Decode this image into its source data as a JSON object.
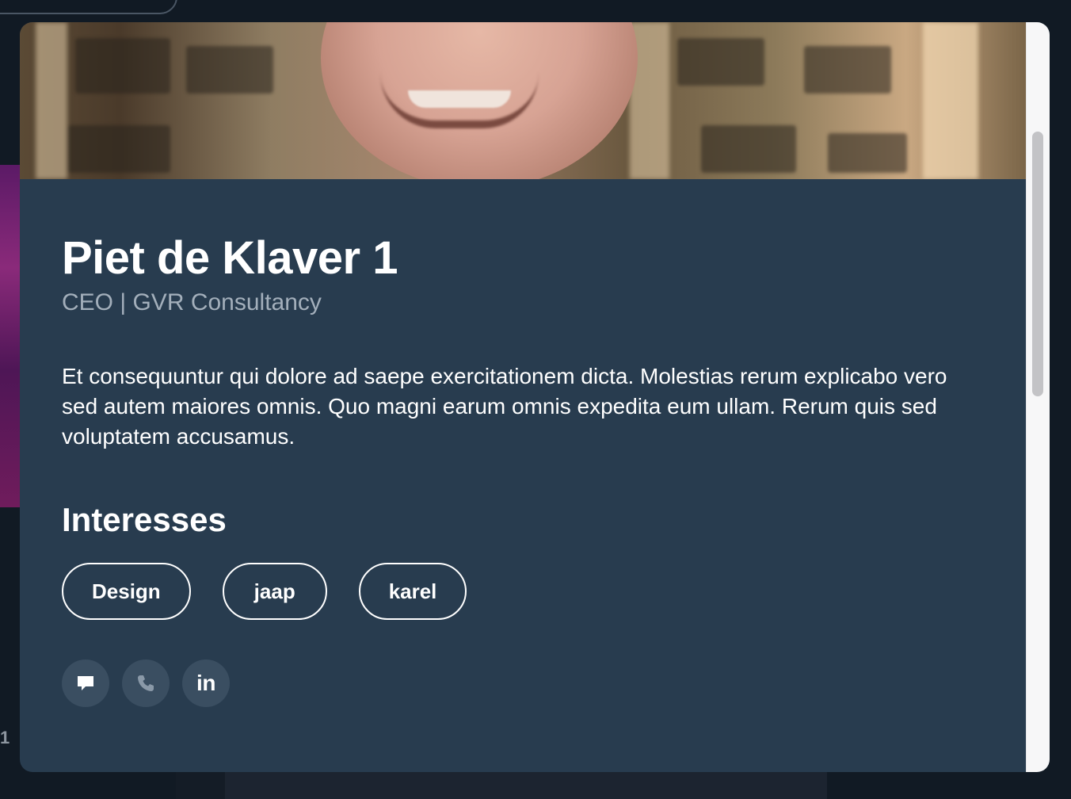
{
  "profile": {
    "name": "Piet de Klaver 1",
    "subtitle": "CEO | GVR Consultancy",
    "bio": "Et consequuntur qui dolore ad saepe exercitationem dicta. Molestias rerum explicabo vero sed autem maiores omnis. Quo magni earum omnis expedita eum ullam. Rerum quis sed voluptatem accusamus."
  },
  "interests": {
    "title": "Interesses",
    "tags": [
      "Design",
      "jaap",
      "karel"
    ]
  },
  "actions": {
    "message_icon": "chat-icon",
    "phone_icon": "phone-icon",
    "linkedin_label": "in"
  },
  "background": {
    "side_number": "1"
  },
  "colors": {
    "modal_bg": "#283c4f",
    "page_bg": "#111a24",
    "action_bg": "#3a4e61",
    "subtitle": "#a3afbb"
  }
}
